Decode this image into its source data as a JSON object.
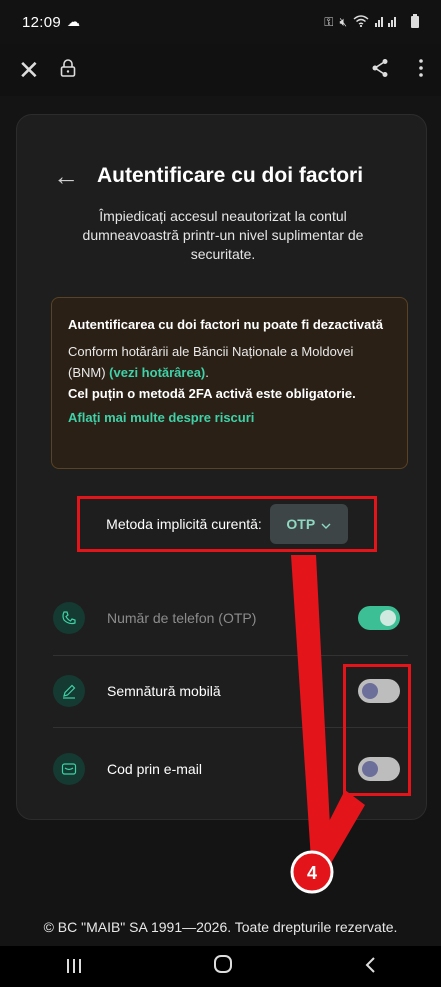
{
  "status_bar": {
    "time": "12:09"
  },
  "browser": {
    "close_icon": "close-icon",
    "lock_icon": "lock-icon",
    "share_icon": "share-icon",
    "menu_icon": "more-vertical-icon"
  },
  "page": {
    "title": "Autentificare cu doi factori",
    "subtitle": "Împiedicați accesul neautorizat la contul dumneavoastră printr-un nivel suplimentar de securitate.",
    "warning": {
      "title": "Autentificarea cu doi factori nu poate fi dezactivată",
      "text_prefix": "Conform hotărârii ale Băncii Naționale a Moldovei (BNM) ",
      "link": "(vezi hotărârea)",
      "text_suffix": ".",
      "bold": "Cel puțin o metodă 2FA activă este obligatorie.",
      "more_link": "Aflați mai multe despre riscuri"
    },
    "method": {
      "label": "Metoda implicită curentă:",
      "value": "OTP"
    },
    "options": [
      {
        "label": "Număr de telefon (OTP)",
        "enabled": true
      },
      {
        "label": "Semnătură mobilă",
        "enabled": false
      },
      {
        "label": "Cod prin e-mail",
        "enabled": false
      }
    ]
  },
  "annotation": {
    "step": "4",
    "color": "#e4141b"
  },
  "footer": "© BC \"MAIB\" SA 1991—2026. Toate drepturile rezervate.",
  "colors": {
    "accent": "#3fd1a8",
    "highlight": "#e4141b",
    "toggle_on": "#3dbf95"
  }
}
